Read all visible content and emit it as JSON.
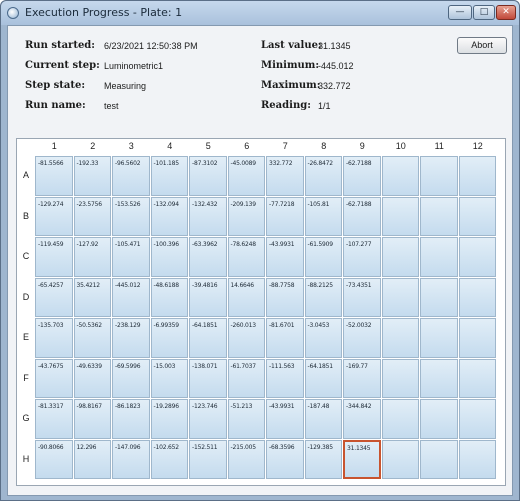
{
  "window": {
    "title": "Execution Progress - Plate: 1",
    "minimize_glyph": "—",
    "maximize_glyph": "□",
    "close_glyph": "✕"
  },
  "info": {
    "run_started_label": "Run started:",
    "run_started_value": "6/23/2021 12:50:38 PM",
    "current_step_label": "Current step:",
    "current_step_value": "Luminometric1",
    "step_state_label": "Step state:",
    "step_state_value": "Measuring",
    "run_name_label": "Run name:",
    "run_name_value": "test",
    "last_value_label": "Last value:",
    "last_value_value": "31.1345",
    "minimum_label": "Minimum:",
    "minimum_value": "-445.012",
    "maximum_label": "Maximum:",
    "maximum_value": "332.772",
    "reading_label": "Reading:",
    "reading_value": "1/1"
  },
  "abort_label": "Abort",
  "plate": {
    "columns": [
      "1",
      "2",
      "3",
      "4",
      "5",
      "6",
      "7",
      "8",
      "9",
      "10",
      "11",
      "12"
    ],
    "rows": [
      "A",
      "B",
      "C",
      "D",
      "E",
      "F",
      "G",
      "H"
    ],
    "values": [
      [
        "-81.5566",
        "-192.33",
        "-96.5602",
        "-101.185",
        "-87.3102",
        "-45.0089",
        "332.772",
        "-26.8472",
        "-62.7188",
        "",
        "",
        ""
      ],
      [
        "-129.274",
        "-23.5756",
        "-153.526",
        "-132.094",
        "-132.432",
        "-209.139",
        "-77.7218",
        "-105.81",
        "-62.7188",
        "",
        "",
        ""
      ],
      [
        "-119.459",
        "-127.92",
        "-105.471",
        "-100.396",
        "-63.3962",
        "-78.6248",
        "-43.9931",
        "-61.5909",
        "-107.277",
        "",
        "",
        ""
      ],
      [
        "-65.4257",
        "35.4212",
        "-445.012",
        "-48.6188",
        "-39.4816",
        "14.6646",
        "-88.7758",
        "-88.2125",
        "-73.4351",
        "",
        "",
        ""
      ],
      [
        "-135.703",
        "-50.5362",
        "-238.129",
        "-6.99359",
        "-64.1851",
        "-260.013",
        "-81.6701",
        "-3.0453",
        "-52.0032",
        "",
        "",
        ""
      ],
      [
        "-43.7675",
        "-49.6339",
        "-69.5996",
        "-15.003",
        "-138.071",
        "-61.7037",
        "-111.563",
        "-64.1851",
        "-169.77",
        "",
        "",
        ""
      ],
      [
        "-81.3317",
        "-98.8167",
        "-86.1823",
        "-19.2896",
        "-123.746",
        "-51.213",
        "-43.9931",
        "-187.48",
        "-344.842",
        "",
        "",
        ""
      ],
      [
        "-90.8066",
        "12.296",
        "-147.096",
        "-102.652",
        "-152.511",
        "-215.005",
        "-68.3596",
        "-129.385",
        "31.1345",
        "",
        "",
        ""
      ]
    ],
    "current_well": "H9"
  }
}
